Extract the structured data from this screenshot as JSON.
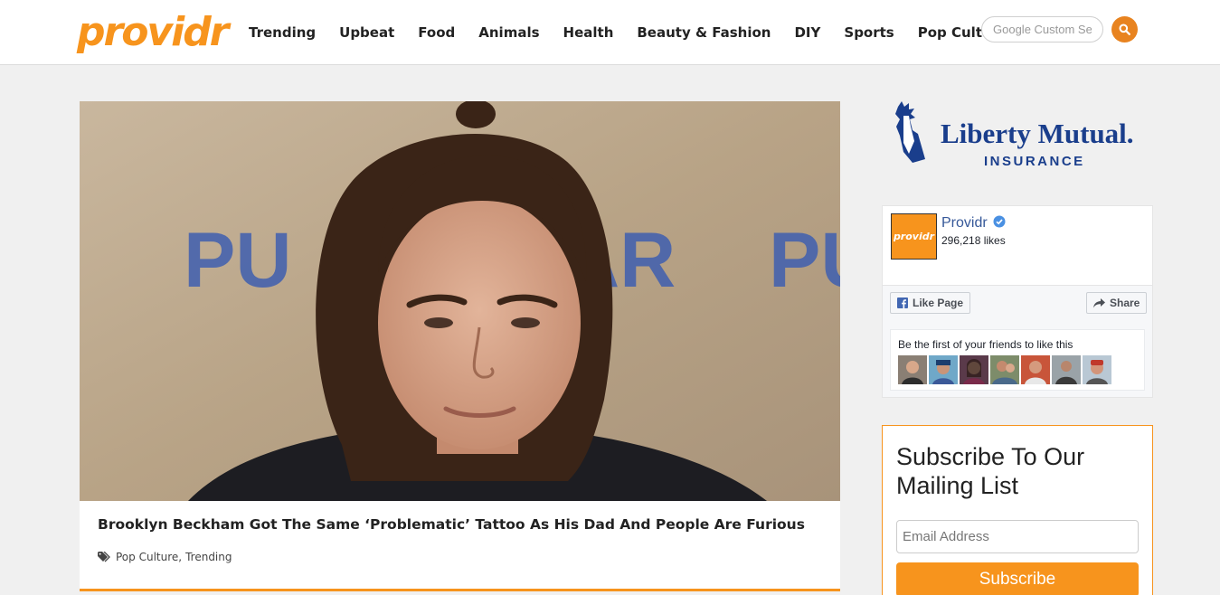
{
  "header": {
    "logo": "providr",
    "nav": [
      "Trending",
      "Upbeat",
      "Food",
      "Animals",
      "Health",
      "Beauty & Fashion",
      "DIY",
      "Sports",
      "Pop Culture"
    ],
    "search_placeholder": "Google Custom Se"
  },
  "article": {
    "title": "Brooklyn Beckham Got The Same ‘Problematic’ Tattoo As His Dad And People Are Furious",
    "tags": [
      "Pop Culture",
      "Trending"
    ],
    "tag_separator": ",",
    "image_text_left": "PU",
    "image_text_mid": "AR",
    "image_text_right": "PU"
  },
  "ad": {
    "brand_line1": "Liberty Mutual.",
    "brand_line2": "INSURANCE"
  },
  "facebook": {
    "page_logo_text": "providr",
    "page_name": "Providr",
    "likes": "296,218 likes",
    "like_button": "Like Page",
    "share_button": "Share",
    "friends_text": "Be the first of your friends to like this"
  },
  "subscribe": {
    "title": "Subscribe To Our Mailing List",
    "email_placeholder": "Email Address",
    "button": "Subscribe"
  },
  "colors": {
    "brand_orange": "#f7941d",
    "facebook_blue": "#365899",
    "liberty_blue": "#1a3e8c"
  }
}
